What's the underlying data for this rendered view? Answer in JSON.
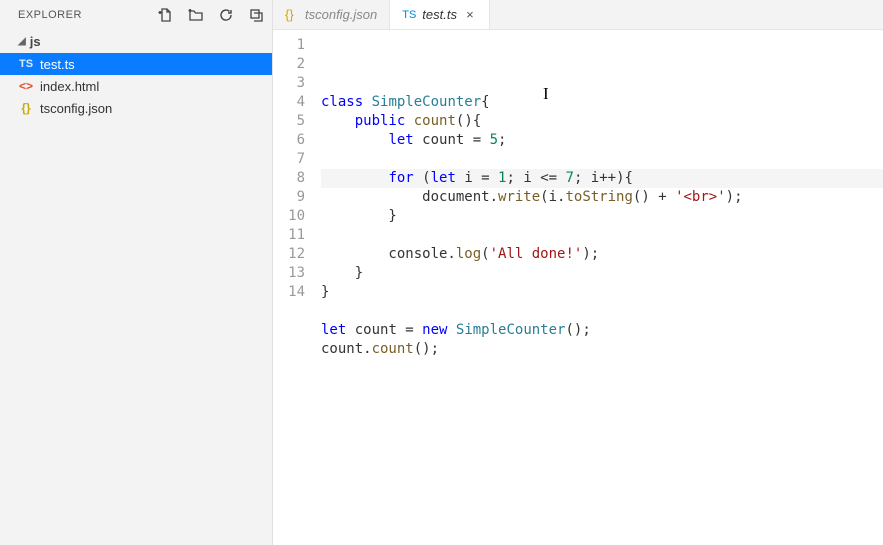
{
  "sidebar": {
    "title": "EXPLORER",
    "folder": "js",
    "files": [
      {
        "name": "test.ts",
        "icon": "TS",
        "iconClass": "ts",
        "selected": true
      },
      {
        "name": "index.html",
        "icon": "<>",
        "iconClass": "html",
        "selected": false
      },
      {
        "name": "tsconfig.json",
        "icon": "{}",
        "iconClass": "json",
        "selected": false
      }
    ]
  },
  "tabs": [
    {
      "name": "tsconfig.json",
      "icon": "{}",
      "iconClass": "json",
      "active": false,
      "showClose": false
    },
    {
      "name": "test.ts",
      "icon": "TS",
      "iconClass": "ts",
      "active": true,
      "showClose": true
    }
  ],
  "closeGlyph": "×",
  "code": {
    "lines": [
      {
        "n": 1,
        "t": [
          [
            "kw",
            "class"
          ],
          [
            "",
            " "
          ],
          [
            "type",
            "SimpleCounter"
          ],
          [
            "",
            "{"
          ]
        ]
      },
      {
        "n": 2,
        "t": [
          [
            "",
            "    "
          ],
          [
            "kw",
            "public"
          ],
          [
            "",
            " "
          ],
          [
            "fn",
            "count"
          ],
          [
            "",
            "(){"
          ]
        ]
      },
      {
        "n": 3,
        "t": [
          [
            "",
            "        "
          ],
          [
            "kw",
            "let"
          ],
          [
            "",
            " count = "
          ],
          [
            "num",
            "5"
          ],
          [
            "",
            ";"
          ]
        ]
      },
      {
        "n": 4,
        "t": [
          [
            "",
            ""
          ]
        ]
      },
      {
        "n": 5,
        "hl": true,
        "t": [
          [
            "",
            "        "
          ],
          [
            "kw",
            "for"
          ],
          [
            "",
            " ("
          ],
          [
            "kw",
            "let"
          ],
          [
            "",
            " i = "
          ],
          [
            "num",
            "1"
          ],
          [
            "",
            "; i <= "
          ],
          [
            "num",
            "7"
          ],
          [
            "",
            "; i++){"
          ]
        ]
      },
      {
        "n": 6,
        "t": [
          [
            "",
            "            document."
          ],
          [
            "fn",
            "write"
          ],
          [
            "",
            "(i."
          ],
          [
            "fn",
            "toString"
          ],
          [
            "",
            "() + "
          ],
          [
            "str",
            "'<br>'"
          ],
          [
            "",
            ");"
          ]
        ]
      },
      {
        "n": 7,
        "t": [
          [
            "",
            "        }"
          ]
        ]
      },
      {
        "n": 8,
        "t": [
          [
            "",
            ""
          ]
        ]
      },
      {
        "n": 9,
        "t": [
          [
            "",
            "        console."
          ],
          [
            "fn",
            "log"
          ],
          [
            "",
            "("
          ],
          [
            "str",
            "'All done!'"
          ],
          [
            "",
            ");"
          ]
        ]
      },
      {
        "n": 10,
        "t": [
          [
            "",
            "    }"
          ]
        ]
      },
      {
        "n": 11,
        "t": [
          [
            "",
            "}"
          ]
        ]
      },
      {
        "n": 12,
        "t": [
          [
            "",
            ""
          ]
        ]
      },
      {
        "n": 13,
        "t": [
          [
            "kw",
            "let"
          ],
          [
            "",
            " count = "
          ],
          [
            "kw",
            "new"
          ],
          [
            "",
            " "
          ],
          [
            "type",
            "SimpleCounter"
          ],
          [
            "",
            "();"
          ]
        ]
      },
      {
        "n": 14,
        "t": [
          [
            "",
            "count."
          ],
          [
            "fn",
            "count"
          ],
          [
            "",
            "();"
          ]
        ]
      }
    ]
  }
}
